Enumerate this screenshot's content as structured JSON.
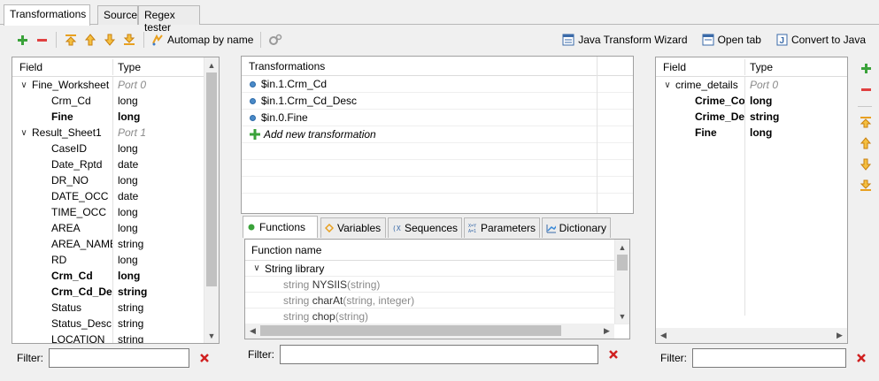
{
  "tabs": [
    {
      "label": "Transformations"
    },
    {
      "label": "Source"
    },
    {
      "label": "Regex tester"
    }
  ],
  "toolbar": {
    "automap_label": "Automap by name",
    "java_wizard_label": "Java Transform Wizard",
    "open_tab_label": "Open tab",
    "convert_java_label": "Convert to Java"
  },
  "left_panel": {
    "field_header": "Field",
    "type_header": "Type",
    "rows": [
      {
        "field": "Fine_Worksheet",
        "type": "Port 0"
      },
      {
        "field": "Crm_Cd",
        "type": "long"
      },
      {
        "field": "Fine",
        "type": "long"
      },
      {
        "field": "Result_Sheet1",
        "type": "Port 1"
      },
      {
        "field": "CaseID",
        "type": "long"
      },
      {
        "field": "Date_Rptd",
        "type": "date"
      },
      {
        "field": "DR_NO",
        "type": "long"
      },
      {
        "field": "DATE_OCC",
        "type": "date"
      },
      {
        "field": "TIME_OCC",
        "type": "long"
      },
      {
        "field": "AREA",
        "type": "long"
      },
      {
        "field": "AREA_NAME",
        "type": "string"
      },
      {
        "field": "RD",
        "type": "long"
      },
      {
        "field": "Crm_Cd",
        "type": "long"
      },
      {
        "field": "Crm_Cd_Desc",
        "type": "string"
      },
      {
        "field": "Status",
        "type": "string"
      },
      {
        "field": "Status_Desc",
        "type": "string"
      },
      {
        "field": "LOCATION",
        "type": "string"
      }
    ]
  },
  "transformations": {
    "header": "Transformations",
    "items": [
      "$in.1.Crm_Cd",
      "$in.1.Crm_Cd_Desc",
      "$in.0.Fine"
    ],
    "add_label": "Add new transformation"
  },
  "function_tabs": [
    {
      "label": "Functions"
    },
    {
      "label": "Variables"
    },
    {
      "label": "Sequences"
    },
    {
      "label": "Parameters"
    },
    {
      "label": "Dictionary"
    }
  ],
  "functions": {
    "header": "Function name",
    "library": "String library",
    "items": [
      {
        "ret": "string",
        "name": "NYSIIS",
        "args": "(string)"
      },
      {
        "ret": "string",
        "name": "charAt",
        "args": "(string, integer)"
      },
      {
        "ret": "string",
        "name": "chop",
        "args": "(string)"
      }
    ]
  },
  "right_panel": {
    "field_header": "Field",
    "type_header": "Type",
    "rows": [
      {
        "field": "crime_details",
        "type": "Port 0"
      },
      {
        "field": "Crime_Code",
        "type": "long"
      },
      {
        "field": "Crime_Desc",
        "type": "string"
      },
      {
        "field": "Fine",
        "type": "long"
      }
    ]
  },
  "filters": {
    "label": "Filter:",
    "left_value": "",
    "middle_value": "",
    "right_value": ""
  },
  "colors": {
    "add_green": "#3aa23a",
    "remove_red": "#e04040",
    "arrow_orange": "#e8a020",
    "clear_red": "#d02020"
  }
}
